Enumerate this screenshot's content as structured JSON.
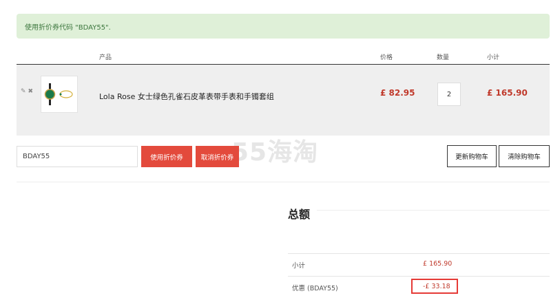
{
  "notice": "使用折价券代码 \"BDAY55\".",
  "table": {
    "headers": {
      "product": "产品",
      "price": "价格",
      "quantity": "数量",
      "subtotal": "小计"
    },
    "item": {
      "name": "Lola Rose 女士绿色孔雀石皮革表带手表和手镯套组",
      "price": "£ 82.95",
      "quantity": "2",
      "subtotal": "£ 165.90"
    }
  },
  "coupon": {
    "code": "BDAY55",
    "apply_label": "使用折价券",
    "remove_label": "取消折价券"
  },
  "cart_actions": {
    "update_label": "更新购物车",
    "clear_label": "清除购物车"
  },
  "totals": {
    "title": "总额",
    "rows": [
      {
        "label": "小计",
        "value": "£ 165.90"
      },
      {
        "label": "优惠 (BDAY55)",
        "value": "-£ 33.18"
      }
    ]
  },
  "watermark": "55海淘",
  "colors": {
    "accent": "#e34a3c",
    "price": "#c0392b",
    "notice_bg": "#dff0d8",
    "highlight": "#e53935"
  }
}
